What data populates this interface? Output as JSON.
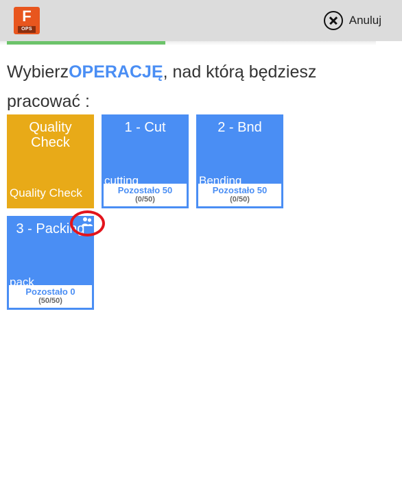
{
  "app": {
    "logo_letter": "F",
    "logo_sub": "OPS"
  },
  "header": {
    "cancel_label": "Anuluj",
    "cancel_icon": "close-circle-icon"
  },
  "progress": {
    "value_fraction": 0.43,
    "color": "#6cc36a"
  },
  "prompt": {
    "prefix": "Wybierz",
    "emphasis": "OPERACJĘ",
    "suffix": ", nad którą będziesz pracować :"
  },
  "operations": [
    {
      "title": "Quality Check",
      "subtitle": "Quality Check",
      "color": "#e8aa18"
    },
    {
      "title": "1 - Cut",
      "subtitle": "cutting",
      "remaining": "Pozostało 50",
      "ratio": "(0/50)",
      "color": "#4a8ef4"
    },
    {
      "title": "2 - Bnd",
      "subtitle": "Bending",
      "remaining": "Pozostało 50",
      "ratio": "(0/50)",
      "color": "#4a8ef4"
    },
    {
      "title": "3 - Packing",
      "subtitle": "pack",
      "remaining": "Pozostało 0",
      "ratio": "(50/50)",
      "color": "#4a8ef4",
      "icon": "group-icon"
    }
  ],
  "annotation": {
    "color": "#e3141c"
  }
}
